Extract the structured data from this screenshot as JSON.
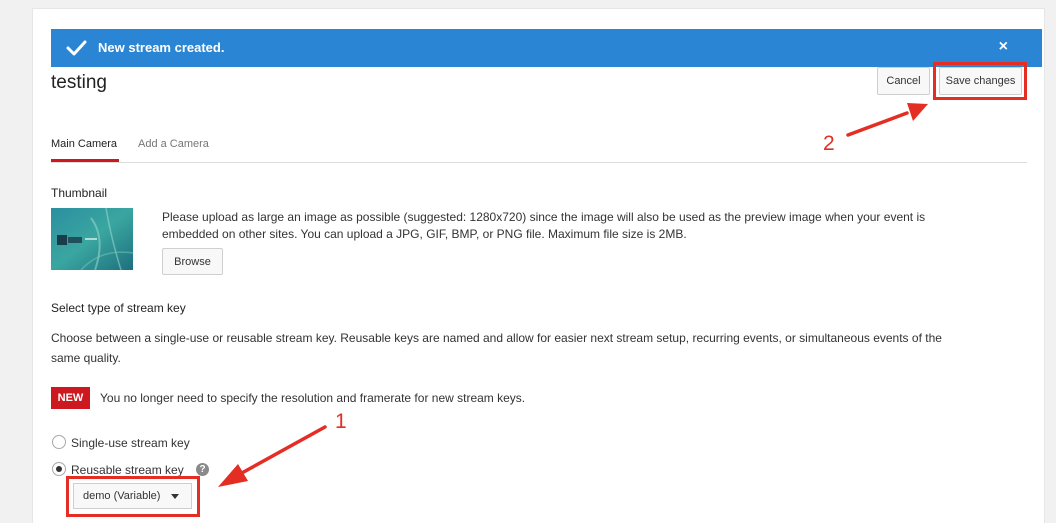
{
  "banner": {
    "message": "New stream created.",
    "close_label": "×"
  },
  "stream": {
    "title": "testing"
  },
  "actions": {
    "cancel_label": "Cancel",
    "save_label": "Save changes"
  },
  "tabs": [
    {
      "label": "Main Camera",
      "active": true
    },
    {
      "label": "Add a Camera",
      "active": false
    }
  ],
  "thumbnail": {
    "heading": "Thumbnail",
    "description_line1": "Please upload as large an image as possible (suggested: 1280x720) since the image will also be used as the preview image when your event is",
    "description_line2": "embedded on other sites. You can upload a JPG, GIF, BMP, or PNG file. Maximum file size is 2MB.",
    "browse_label": "Browse"
  },
  "stream_key": {
    "heading": "Select type of stream key",
    "description_line1": "Choose between a single-use or reusable stream key. Reusable keys are named and allow for easier next stream setup, recurring events, or simultaneous events of the",
    "description_line2": "same quality.",
    "new_badge": "NEW",
    "new_notice": "You no longer need to specify the resolution and framerate for new stream keys.",
    "options": [
      {
        "label": "Single-use stream key",
        "selected": false
      },
      {
        "label": "Reusable stream key",
        "selected": true
      }
    ],
    "help_icon": "?",
    "selected_key": "demo (Variable)"
  },
  "annotations": {
    "step1": "1",
    "step2": "2"
  },
  "colors": {
    "banner": "#2a86d4",
    "accent_red": "#cc181e",
    "annotation_red": "#e52e23"
  }
}
